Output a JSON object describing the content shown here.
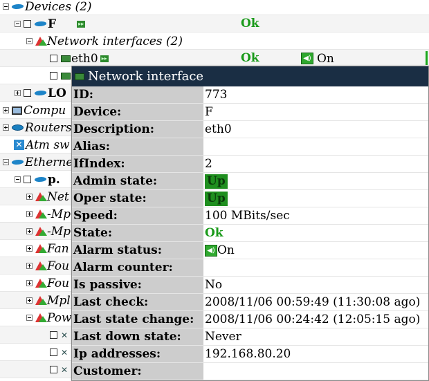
{
  "tree": {
    "devices": {
      "label": "Devices (2)"
    },
    "device1": {
      "label": "F",
      "state": "Ok"
    },
    "net_ifaces": {
      "label": "Network interfaces (2)"
    },
    "eth0": {
      "label": "eth0",
      "state": "Ok",
      "alarm": "On"
    },
    "lo": {
      "label": "LO"
    },
    "computers": {
      "label": "Compu"
    },
    "routers": {
      "label": "Routers"
    },
    "atm": {
      "label": "Atm sw"
    },
    "ethernet": {
      "label": "Etherne"
    },
    "p": {
      "label": "p."
    },
    "sub_items": [
      "Net",
      "-Mp",
      "-Mp",
      "Fan",
      "Fou",
      "Fou",
      "Mpl",
      "Pow"
    ]
  },
  "popup": {
    "title": "Network interface",
    "rows": [
      {
        "label": "ID:",
        "value": "773"
      },
      {
        "label": "Device:",
        "value": "F"
      },
      {
        "label": "Description:",
        "value": "eth0"
      },
      {
        "label": "Alias:",
        "value": ""
      },
      {
        "label": "IfIndex:",
        "value": "2"
      },
      {
        "label": "Admin state:",
        "value": "Up"
      },
      {
        "label": "Oper state:",
        "value": "Up"
      },
      {
        "label": "Speed:",
        "value": "100 MBits/sec"
      },
      {
        "label": "State:",
        "value": "Ok"
      },
      {
        "label": "Alarm status:",
        "value": "On"
      },
      {
        "label": "Alarm counter:",
        "value": ""
      },
      {
        "label": "Is passive:",
        "value": "No"
      },
      {
        "label": "Last check:",
        "value": "2008/11/06 00:59:49 (11:30:08 ago)"
      },
      {
        "label": "Last state change:",
        "value": "2008/11/06 00:24:42 (12:05:15 ago)"
      },
      {
        "label": "Last down state:",
        "value": "Never"
      },
      {
        "label": "Ip addresses:",
        "value": "192.168.80.20"
      },
      {
        "label": "Customer:",
        "value": ""
      }
    ]
  },
  "colors": {
    "ok": "#1a9a1a",
    "title_bg": "#1a2e44",
    "label_bg": "#cdcdcd",
    "badge": "#1f8f1f"
  }
}
